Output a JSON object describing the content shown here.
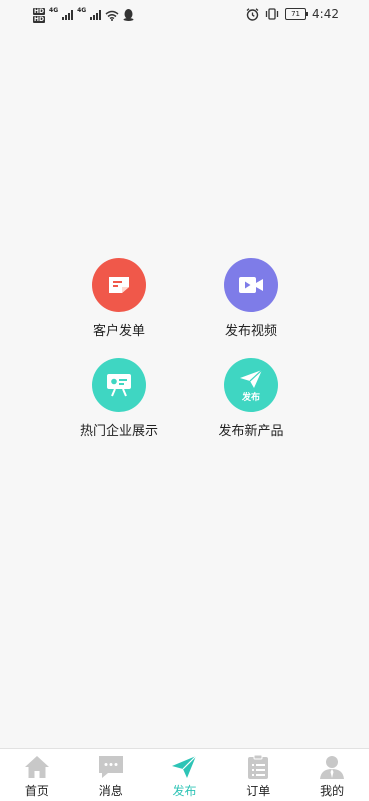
{
  "status_bar": {
    "hd1": "HD",
    "hd2": "HD",
    "net1": "4G",
    "net2": "4G",
    "battery": "71",
    "time": "4:42"
  },
  "grid": [
    {
      "label": "客户发单",
      "icon": "order-note-icon",
      "color": "#f0584a"
    },
    {
      "label": "发布视频",
      "icon": "video-icon",
      "color": "#7e7ce8"
    },
    {
      "label": "热门企业展示",
      "icon": "presentation-board-icon",
      "color": "#3fd6c2"
    },
    {
      "label": "发布新产品",
      "icon": "paper-plane-icon",
      "color": "#3fd6c2",
      "badge": "发布"
    }
  ],
  "tabs": [
    {
      "label": "首页",
      "icon": "home-icon"
    },
    {
      "label": "消息",
      "icon": "message-icon"
    },
    {
      "label": "发布",
      "icon": "paper-plane-icon",
      "active": true
    },
    {
      "label": "订单",
      "icon": "clipboard-icon"
    },
    {
      "label": "我的",
      "icon": "user-icon"
    }
  ],
  "colors": {
    "accent": "#2ec4b6",
    "tab_icon_inactive": "#c8c8c8",
    "background": "#f7f7f7"
  }
}
